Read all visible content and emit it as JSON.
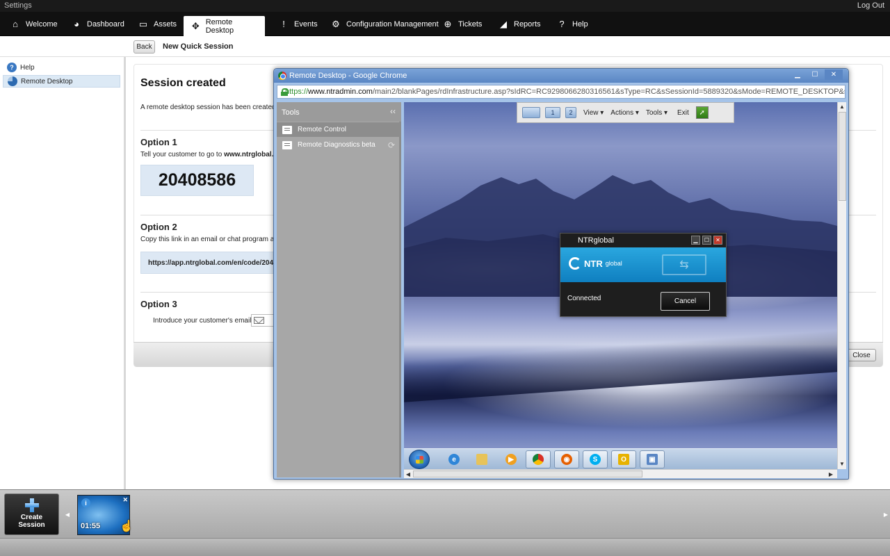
{
  "topbar": {
    "title": "Settings",
    "logout": "Log Out"
  },
  "nav": {
    "items": [
      {
        "label": "Welcome",
        "icon": "home-icon"
      },
      {
        "label": "Dashboard",
        "icon": "dashboard-icon"
      },
      {
        "label": "Assets",
        "icon": "monitor-icon"
      },
      {
        "label": "Remote Desktop",
        "icon": "remote-desktop-icon",
        "active": true
      },
      {
        "label": "Events",
        "icon": "exclamation-icon"
      },
      {
        "label": "Configuration Management",
        "icon": "gear-icon"
      },
      {
        "label": "Tickets",
        "icon": "lifebuoy-icon"
      },
      {
        "label": "Reports",
        "icon": "chart-icon"
      },
      {
        "label": "Help",
        "icon": "help-icon"
      }
    ]
  },
  "subheader": {
    "back_label": "Back",
    "title": "New Quick Session"
  },
  "sidebar": {
    "items": [
      {
        "label": "Help"
      },
      {
        "label": "Remote Desktop",
        "active": true
      }
    ]
  },
  "main": {
    "heading": "Session created",
    "created_text": "A remote desktop session has been created",
    "option1": {
      "title": "Option 1",
      "text_prefix": "Tell your customer to go to",
      "text_link": "www.ntrglobal.",
      "code": "20408586"
    },
    "option2": {
      "title": "Option 2",
      "text": "Copy this link in an email or chat program and",
      "link": "https://app.ntrglobal.com/en/code/204"
    },
    "option3": {
      "title": "Option 3",
      "email_label": "Introduce your customer's email"
    },
    "close_label": "Close"
  },
  "popup": {
    "title": "Remote Desktop - Google Chrome",
    "url_scheme": "https://",
    "url_host": "www.ntradmin.com",
    "url_rest": "/main2/blankPages/rdInfrastructure.asp?sIdRC=RC9298066280316561&sType=RC&sSessionId=5889320&sMode=REMOTE_DESKTOP&sTitle=",
    "tools": {
      "header": "Tools",
      "items": [
        {
          "label": "Remote Control",
          "active": true
        },
        {
          "label": "Remote Diagnostics beta"
        }
      ]
    },
    "rd_toolbar": {
      "monitor1": "1",
      "monitor2": "2",
      "view": "View ▾",
      "actions": "Actions ▾",
      "tools": "Tools ▾",
      "exit": "Exit"
    },
    "dialog": {
      "title": "NTRglobal",
      "logo": "NTR",
      "logo_sub": "global",
      "status": "Connected",
      "cancel": "Cancel"
    }
  },
  "bottom": {
    "create_label_1": "Create",
    "create_label_2": "Session",
    "session_time": "01:55"
  }
}
